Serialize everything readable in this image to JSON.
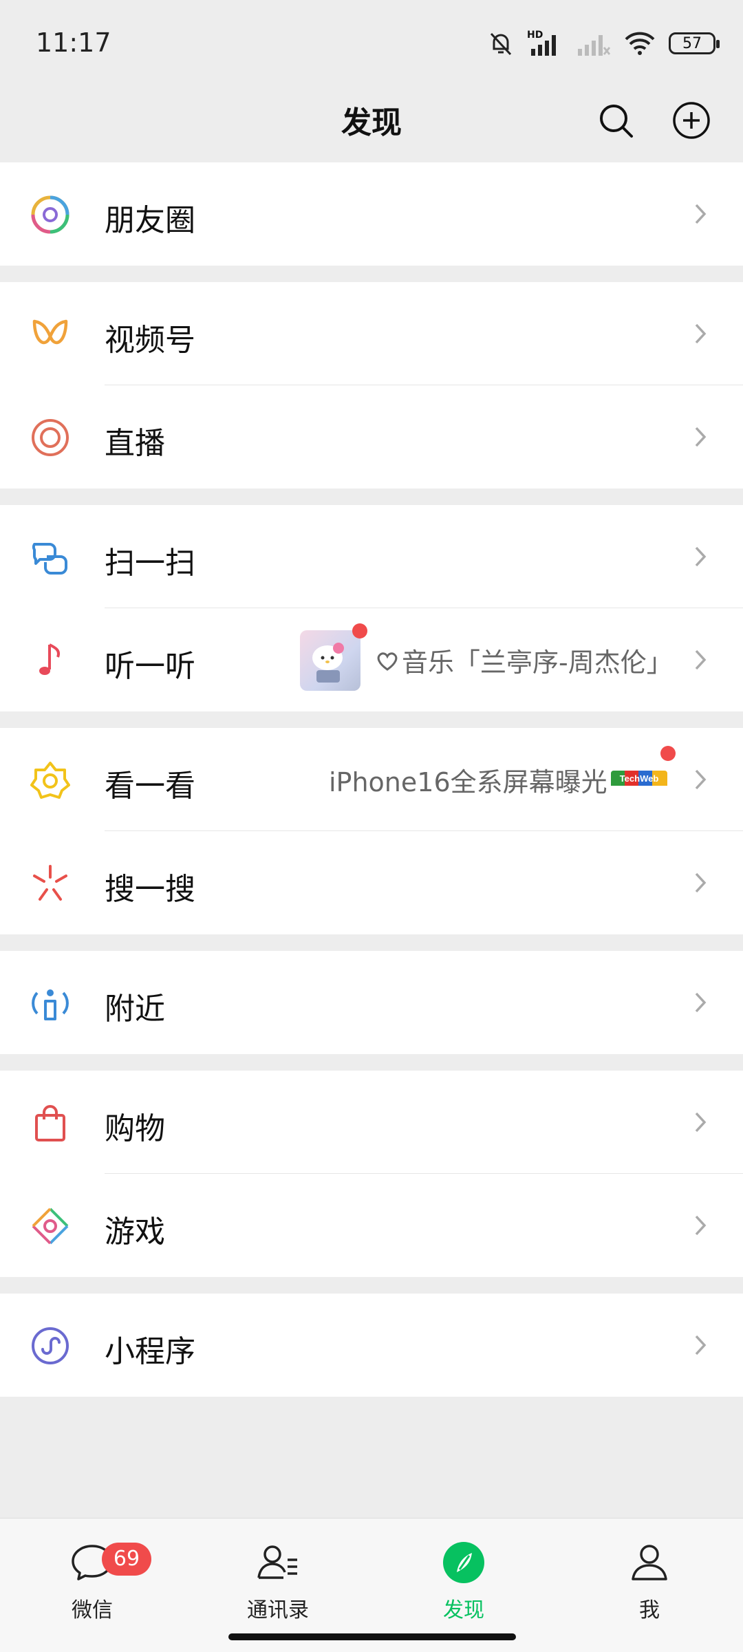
{
  "status": {
    "time": "11:17",
    "battery": "57",
    "network": "HD"
  },
  "header": {
    "title": "发现"
  },
  "menu": {
    "moments": "朋友圈",
    "channels": "视频号",
    "live": "直播",
    "scan": "扫一扫",
    "listen": "听一听",
    "listen_extra": "音乐「兰亭序-周杰伦」",
    "topstories": "看一看",
    "topstories_extra": "iPhone16全系屏幕曝光",
    "topstories_source": "TechWeb",
    "search": "搜一搜",
    "nearby": "附近",
    "shopping": "购物",
    "games": "游戏",
    "miniprograms": "小程序"
  },
  "tabs": {
    "chats": "微信",
    "chats_badge": "69",
    "contacts": "通讯录",
    "discover": "发现",
    "me": "我"
  },
  "colors": {
    "accent": "#07c160",
    "badge": "#f04b4b"
  }
}
